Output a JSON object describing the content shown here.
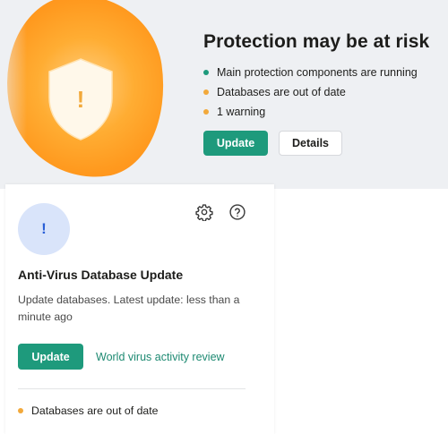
{
  "banner": {
    "title": "Protection may be at risk",
    "status_items": [
      {
        "text": "Main protection components are running",
        "color": "#1e9a7c"
      },
      {
        "text": "Databases are out of date",
        "color": "#f2a93b"
      },
      {
        "text": "1 warning",
        "color": "#f2a93b"
      }
    ],
    "update_label": "Update",
    "details_label": "Details",
    "shield_symbol": "!",
    "glow_color": "#ff9a1f"
  },
  "card": {
    "icon_symbol": "!",
    "settings_icon": "gear-icon",
    "help_icon": "question-icon",
    "title": "Anti-Virus Database Update",
    "description": "Update databases. Latest update: less than a minute ago",
    "update_label": "Update",
    "link_label": "World virus activity review",
    "status": {
      "text": "Databases are out of date",
      "color": "#f2a93b"
    }
  },
  "colors": {
    "accent": "#1e9a7c",
    "warning": "#f2a93b",
    "link": "#1e8a72"
  }
}
